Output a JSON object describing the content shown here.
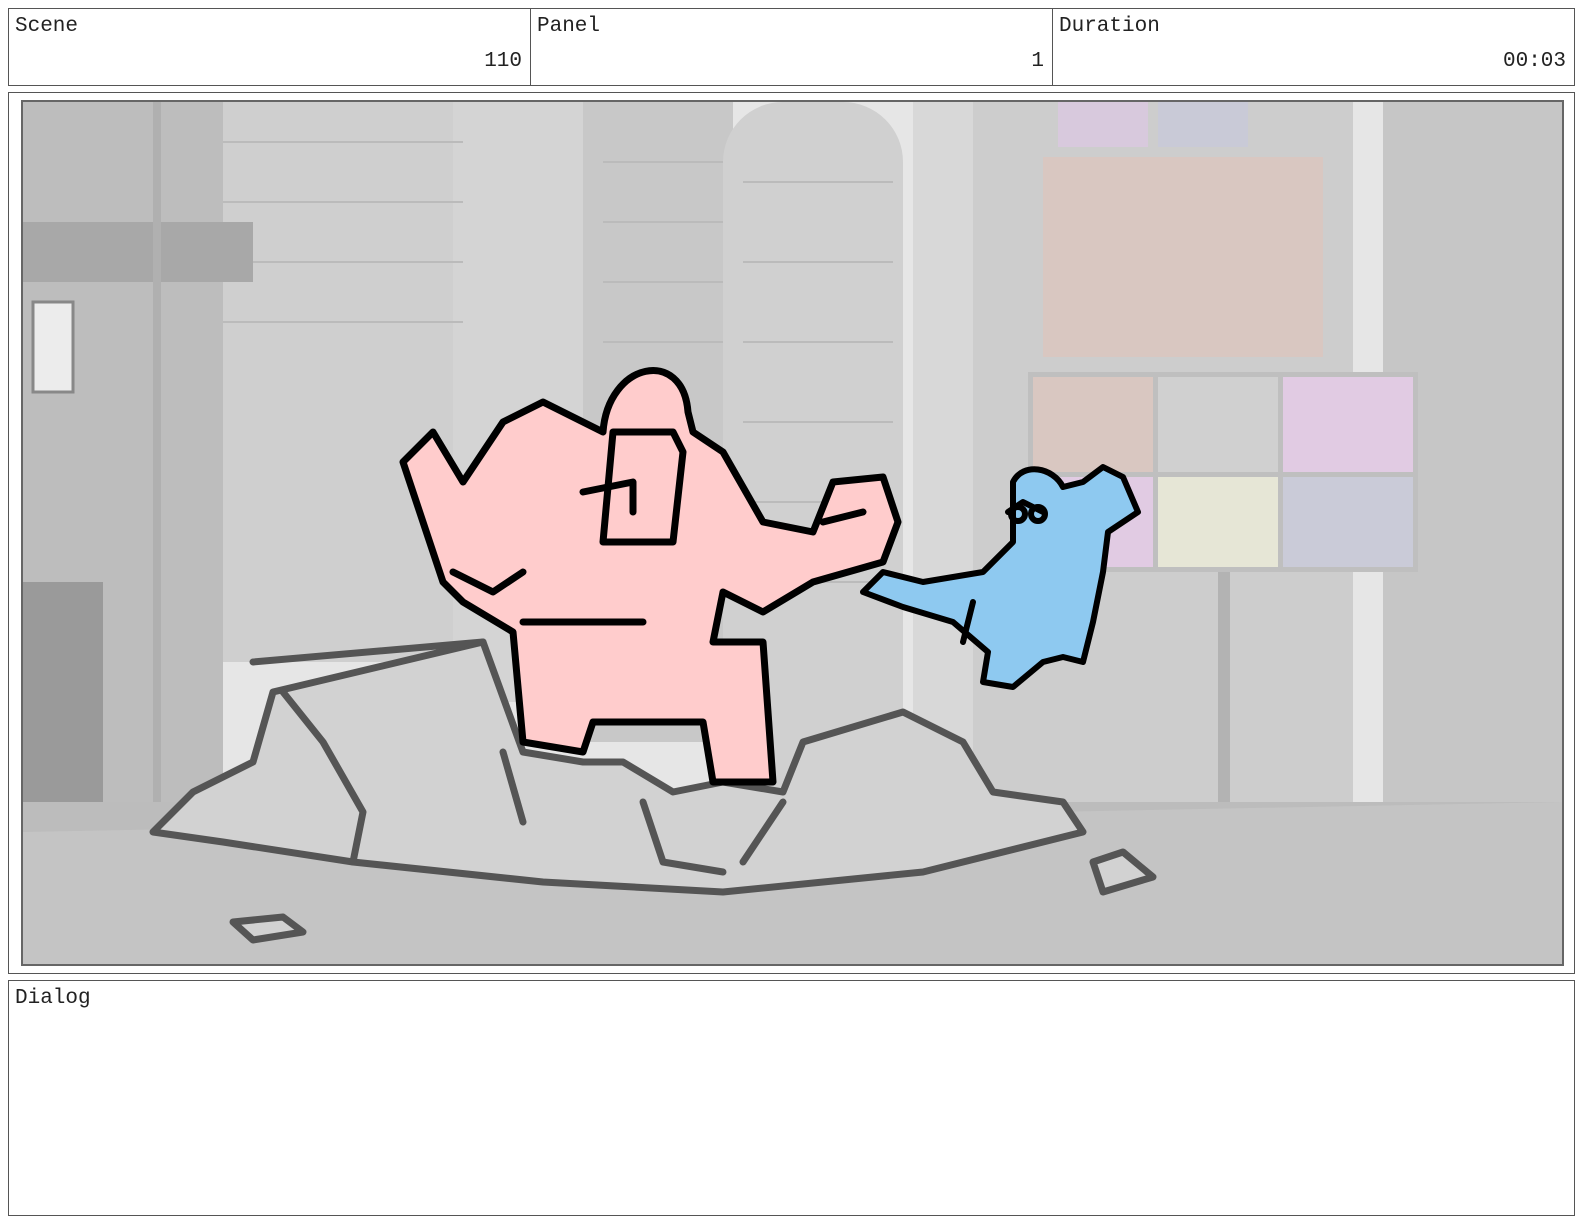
{
  "header": {
    "scene_label": "Scene",
    "scene_value": "110",
    "panel_label": "Panel",
    "panel_value": "1",
    "duration_label": "Duration",
    "duration_value": "00:03"
  },
  "dialog": {
    "label": "Dialog",
    "text": ""
  },
  "colors": {
    "robot_fill": "#ffcccc",
    "hero_fill": "#8ec9f0",
    "rubble_fill": "#d2d2d2",
    "ink": "#000000",
    "rubble_ink": "#555555"
  }
}
